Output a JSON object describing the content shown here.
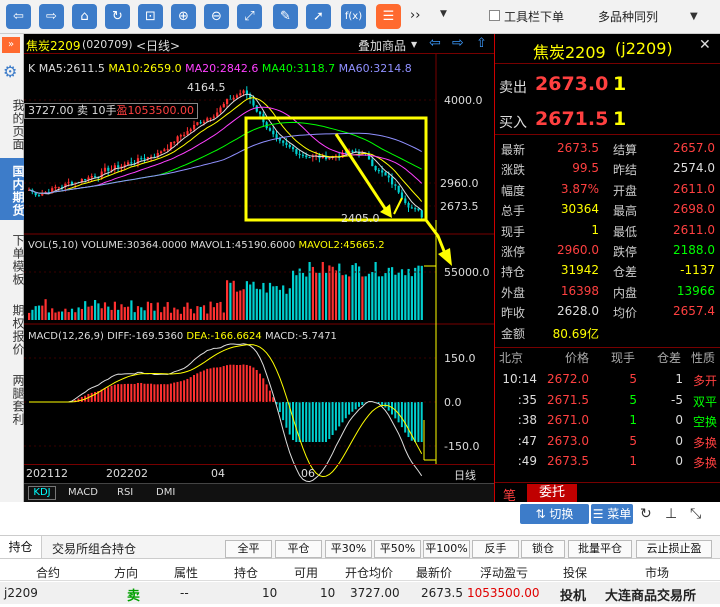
{
  "toolbar": {
    "tools_label": "工具栏下单",
    "multi_label": "多品种同列",
    "more": "››"
  },
  "sidebar": {
    "items": [
      "我的页面",
      "国内期货",
      "下单模板",
      "期权报价",
      "两腿套利"
    ]
  },
  "chart": {
    "title": "焦炭2209",
    "code": "(020709)",
    "period": "<日线>",
    "overlay": "叠加商品",
    "ma_line": {
      "ma5": "K MA5:2611.5",
      "ma10": "MA10:2659.0",
      "ma20": "MA20:2842.6",
      "ma40": "MA40:3118.7",
      "ma60": "MA60:3214.8"
    },
    "position_label": "3727.00 卖 10手",
    "position_profit": "盈1053500.00",
    "high_label": "4164.5",
    "low_label": "2405.0",
    "price_ticks": [
      "4000.0",
      "2960.0",
      "2673.5"
    ],
    "vol_line": {
      "vol": "VOL(5,10) VOLUME:30364.0000",
      "mavol1": "MAVOL1:45190.6000",
      "mavol2": "MAVOL2:45665.2"
    },
    "vol_tick": "55000.0",
    "macd_line": {
      "macd": "MACD(12,26,9) DIFF:-169.5360",
      "dea": "DEA:-166.6624",
      "val": "MACD:-5.7471"
    },
    "macd_ticks": [
      "150.0",
      "0.0",
      "-150.0"
    ],
    "date_ticks": [
      "202112",
      "202202",
      "04",
      "06"
    ],
    "date_unit": "日线",
    "indicator_tabs": [
      "KDJ",
      "MACD",
      "RSI",
      "DMI"
    ]
  },
  "quote": {
    "name": "焦炭2209",
    "code": "(j2209)",
    "sell_label": "卖出",
    "sell_price": "2673.0",
    "sell_qty": "1",
    "buy_label": "买入",
    "buy_price": "2671.5",
    "buy_qty": "1",
    "stats": [
      {
        "k1": "最新",
        "v1": "2673.5",
        "c1": "red",
        "k2": "结算",
        "v2": "2657.0",
        "c2": "red"
      },
      {
        "k1": "涨跌",
        "v1": "99.5",
        "c1": "red",
        "k2": "昨结",
        "v2": "2574.0",
        "c2": "white"
      },
      {
        "k1": "幅度",
        "v1": "3.87%",
        "c1": "red",
        "k2": "开盘",
        "v2": "2611.0",
        "c2": "red"
      },
      {
        "k1": "总手",
        "v1": "30364",
        "c1": "yellow",
        "k2": "最高",
        "v2": "2698.0",
        "c2": "red"
      },
      {
        "k1": "现手",
        "v1": "1",
        "c1": "yellow",
        "k2": "最低",
        "v2": "2611.0",
        "c2": "red"
      },
      {
        "k1": "涨停",
        "v1": "2960.0",
        "c1": "red",
        "k2": "跌停",
        "v2": "2188.0",
        "c2": "green"
      },
      {
        "k1": "持仓",
        "v1": "31942",
        "c1": "yellow",
        "k2": "仓差",
        "v2": "-1137",
        "c2": "yellow"
      },
      {
        "k1": "外盘",
        "v1": "16398",
        "c1": "red",
        "k2": "内盘",
        "v2": "13966",
        "c2": "green"
      },
      {
        "k1": "昨收",
        "v1": "2628.0",
        "c1": "white",
        "k2": "均价",
        "v2": "2657.4",
        "c2": "red"
      },
      {
        "k1": "金额",
        "v1": "80.69亿",
        "c1": "yellow",
        "k2": "",
        "v2": "",
        "c2": "white"
      }
    ],
    "tick_headers": [
      "北京",
      "价格",
      "现手",
      "仓差",
      "性质"
    ],
    "ticks": [
      {
        "t": "10:14",
        "p": "2672.0",
        "q": "5",
        "d": "1",
        "n": "多开",
        "pc": "red",
        "qc": "red",
        "nc": "red"
      },
      {
        "t": ":35",
        "p": "2671.5",
        "q": "5",
        "d": "-5",
        "n": "双平",
        "pc": "red",
        "qc": "green",
        "nc": "green"
      },
      {
        "t": ":38",
        "p": "2671.0",
        "q": "1",
        "d": "0",
        "n": "空换",
        "pc": "red",
        "qc": "green",
        "nc": "green"
      },
      {
        "t": ":47",
        "p": "2673.0",
        "q": "5",
        "d": "0",
        "n": "多换",
        "pc": "red",
        "qc": "red",
        "nc": "red"
      },
      {
        "t": ":49",
        "p": "2673.5",
        "q": "1",
        "d": "0",
        "n": "多换",
        "pc": "red",
        "qc": "red",
        "nc": "red"
      }
    ],
    "tabs": [
      "笔",
      "委托"
    ]
  },
  "actions": {
    "switch": "切换",
    "menu": "菜单"
  },
  "positions": {
    "tabs": [
      "持仓",
      "交易所组合持仓"
    ],
    "buttons": [
      "全平",
      "平仓",
      "平30%",
      "平50%",
      "平100%",
      "反手",
      "锁仓",
      "批量平仓",
      "云止损止盈"
    ],
    "headers": [
      "合约",
      "方向",
      "属性",
      "持仓",
      "可用",
      "开仓均价",
      "最新价",
      "浮动盈亏",
      "投保",
      "市场"
    ],
    "row": [
      "j2209",
      "卖",
      "--",
      "10",
      "10",
      "3727.00",
      "2673.5",
      "1053500.00",
      "投机",
      "大连商品交易所"
    ]
  }
}
